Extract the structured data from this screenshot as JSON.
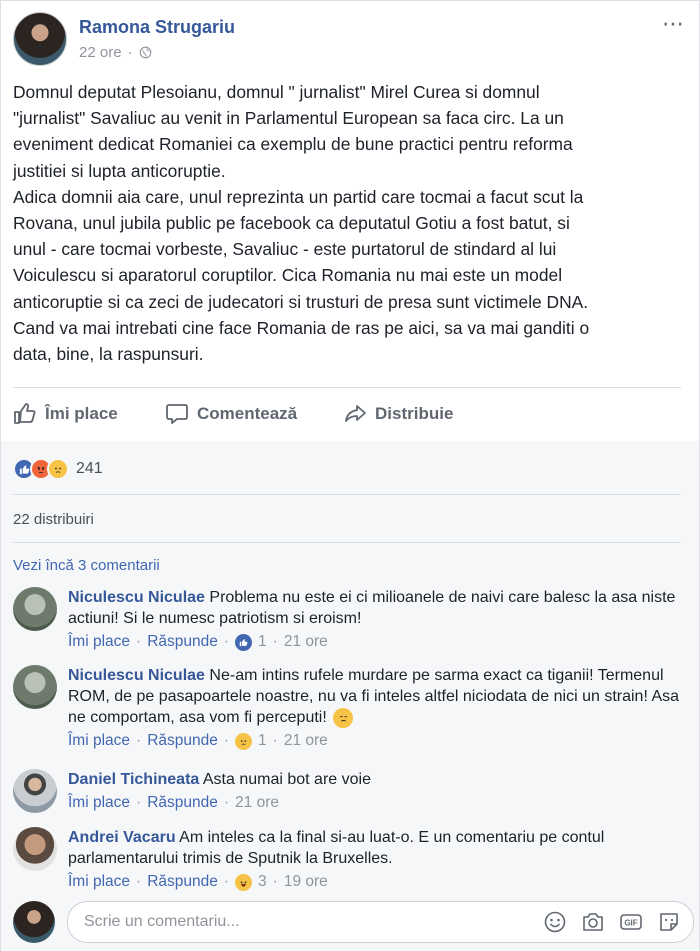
{
  "post": {
    "author": "Ramona Strugariu",
    "time": "22 ore",
    "more_icon": "⋯",
    "text": "Domnul deputat Plesoianu, domnul \" jurnalist\" Mirel Curea si domnul\n\"jurnalist\" Savaliuc au venit in Parlamentul European sa faca circ. La un\neveniment dedicat Romaniei ca exemplu de bune practici pentru reforma\njustitiei si lupta anticoruptie.\nAdica domnii aia care, unul reprezinta un partid care tocmai a facut scut la\nRovana, unul jubila public pe facebook ca deputatul Gotiu a fost batut, si\nunul - care tocmai vorbeste, Savaliuc - este purtatorul de stindard al lui\nVoiculescu si aparatorul coruptilor. Cica Romania nu mai este un model\nanticoruptie si ca zeci de judecatori si trusturi de presa sunt victimele DNA.\nCand va mai intrebati cine face Romania de ras pe aici, sa va mai ganditi o\ndata, bine, la raspunsuri."
  },
  "actions": {
    "like": "Îmi place",
    "comment": "Comentează",
    "share": "Distribuie"
  },
  "reactions": {
    "count": "241",
    "types": [
      "like",
      "angry",
      "sad"
    ]
  },
  "shares": "22 distribuiri",
  "view_more_comments": "Vezi încă 3 comentarii",
  "comments": [
    {
      "name": "Niculescu Niculae",
      "text": "Problema nu este ei ci milioanele de naivi care balesc la asa niste actiuni! Si le numesc patriotism si eroism!",
      "like": "Îmi place",
      "reply": "Răspunde",
      "reaction": "like",
      "count": "1",
      "time": "21 ore"
    },
    {
      "name": "Niculescu Niculae",
      "text": "Ne-am intins rufele murdare pe sarma exact ca tiganii! Termenul ROM, de pe pasapoartele noastre, nu va fi inteles altfel niciodata de nici un strain! Asa ne comportam, asa vom fi perceputi!",
      "like": "Îmi place",
      "reply": "Răspunde",
      "reaction": "sad",
      "count": "1",
      "time": "21 ore"
    },
    {
      "name": "Daniel Tichineata",
      "text": "Asta numai bot are voie",
      "like": "Îmi place",
      "reply": "Răspunde",
      "time": "21 ore"
    },
    {
      "name": "Andrei Vacaru",
      "text": "Am inteles ca la final si-au luat-o. E un comentariu pe contul parlamentarului trimis de Sputnik la Bruxelles.",
      "like": "Îmi place",
      "reply": "Răspunde",
      "reaction": "haha",
      "count": "3",
      "time": "19 ore"
    }
  ],
  "reply": {
    "placeholder": "Scrie un comentariu...",
    "icons": [
      "emoji-icon",
      "camera-icon",
      "gif-icon",
      "sticker-icon"
    ]
  }
}
